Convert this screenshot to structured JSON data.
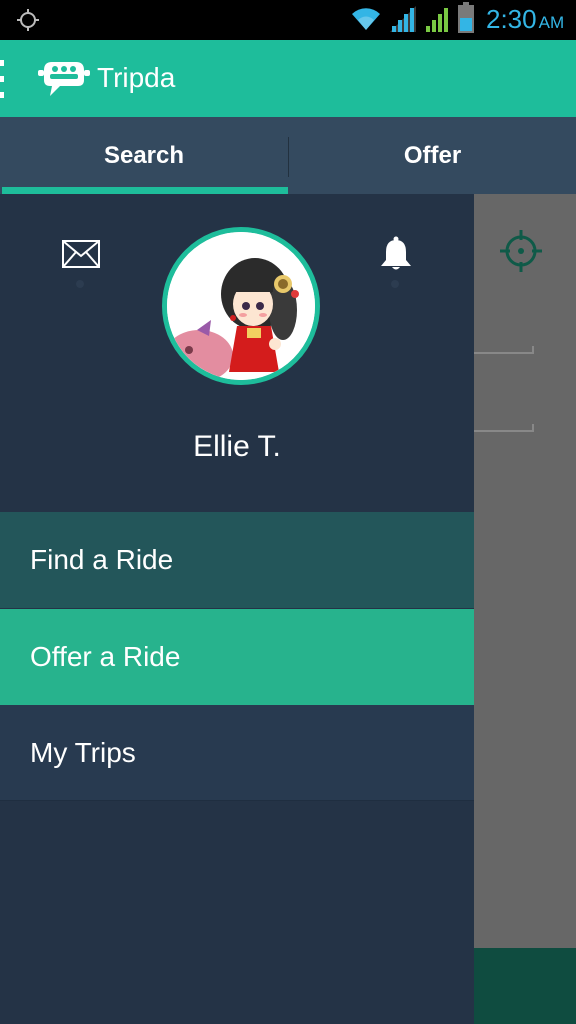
{
  "status_bar": {
    "time": "2:30",
    "ampm": "AM",
    "icons": [
      "gps-icon",
      "wifi-icon",
      "signal-icon",
      "signal-icon",
      "battery-icon"
    ],
    "accent_color": "#33b5e5"
  },
  "app_bar": {
    "title": "Tripda",
    "color": "#1ebd9b",
    "icons": [
      "menu-icon",
      "tripda-logo-icon"
    ]
  },
  "tabs": [
    {
      "label": "Search",
      "selected": true
    },
    {
      "label": "Offer",
      "selected": false
    }
  ],
  "drawer": {
    "user_name": "Ellie T.",
    "header_icons": [
      "mail-icon",
      "bell-icon"
    ],
    "menu_items": [
      {
        "label": "Find a Ride",
        "state": "normal"
      },
      {
        "label": "Offer a Ride",
        "state": "highlighted"
      },
      {
        "label": "My Trips",
        "state": "normal"
      }
    ],
    "background_color": "#243346",
    "highlight_color": "#27b38d"
  },
  "background_content": {
    "icons": [
      "locate-target-icon"
    ]
  }
}
